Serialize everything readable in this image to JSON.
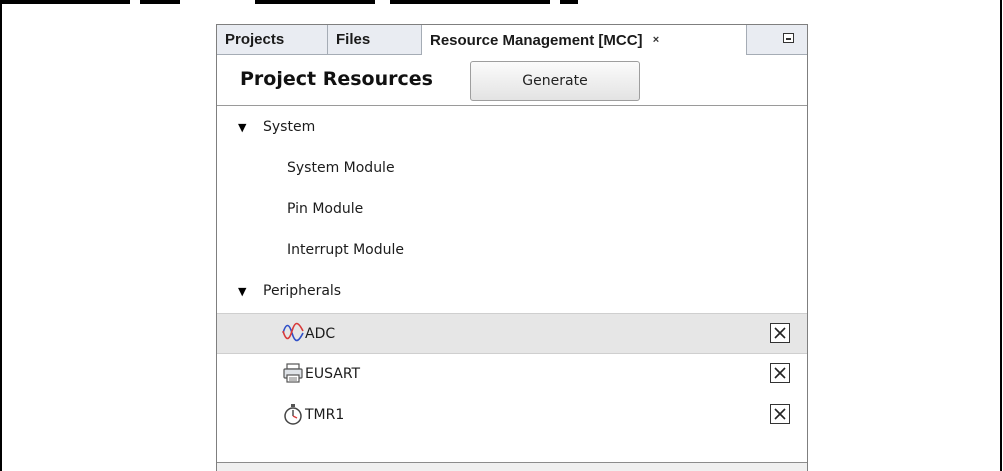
{
  "tabs": {
    "projects": "Projects",
    "files": "Files",
    "resource_management": "Resource Management [MCC]",
    "close_glyph": "×"
  },
  "header": {
    "title": "Project Resources",
    "generate_label": "Generate"
  },
  "tree": {
    "system": {
      "label": "System",
      "children": [
        "System Module",
        "Pin Module",
        "Interrupt Module"
      ]
    },
    "peripherals": {
      "label": "Peripherals",
      "children": [
        {
          "label": "ADC",
          "icon": "waveform-icon",
          "selected": true
        },
        {
          "label": "EUSART",
          "icon": "printer-icon",
          "selected": false
        },
        {
          "label": "TMR1",
          "icon": "stopwatch-icon",
          "selected": false
        }
      ]
    }
  },
  "colors": {
    "tabbar_bg": "#e9ecf2",
    "selected_row": "#e6e6e6",
    "waveform_red": "#d83a3a",
    "waveform_blue": "#3050c8"
  }
}
